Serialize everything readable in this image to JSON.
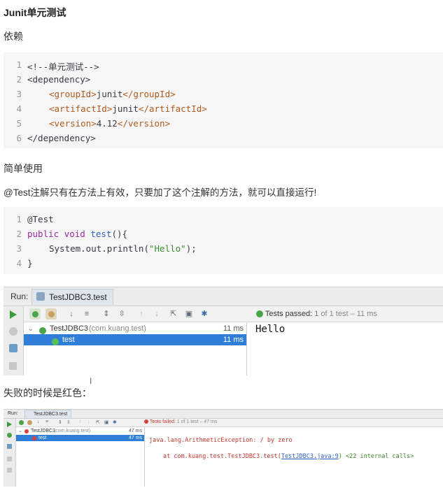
{
  "heading": "Junit单元测试",
  "dep_label": "依赖",
  "dep_code": {
    "line_numbers": [
      "1",
      "2",
      "3",
      "4",
      "5",
      "6"
    ],
    "comment": "<!--单元测试-->",
    "open_dep": "<dependency>",
    "group": {
      "open": "<groupId>",
      "value": "junit",
      "close": "</groupId>"
    },
    "artifact": {
      "open": "<artifactId>",
      "value": "junit",
      "close": "</artifactId>"
    },
    "version": {
      "open": "<version>",
      "value": "4.12",
      "close": "</version>"
    },
    "close_dep": "</dependency>"
  },
  "simple_label": "简单使用",
  "simple_desc": "@Test注解只有在方法上有效，只要加了这个注解的方法，就可以直接运行!",
  "test_code": {
    "line_numbers": [
      "1",
      "2",
      "3",
      "4"
    ],
    "annotation": "@Test",
    "kw_public": "public",
    "kw_void": "void",
    "method": "test",
    "sig_rest": "(){",
    "call": "System.out.println(",
    "str": "\"Hello\"",
    "call_end": ");",
    "close": "}"
  },
  "ide_pass": {
    "run_label": "Run:",
    "tab_label": "TestJDBC3.test",
    "status_prefix": "Tests passed:",
    "status_count": "1",
    "status_rest": "of 1 test – 11 ms",
    "class_name": "TestJDBC3",
    "class_pkg": "(com.kuang.test)",
    "class_time": "11 ms",
    "method_name": "test",
    "method_time": "11 ms",
    "output": "Hello"
  },
  "fail_label": "失败的时候是红色：",
  "ide_fail": {
    "run_label": "Run:",
    "tab_label": "TestJDBC3.test",
    "status_prefix": "Tests failed:",
    "status_rest": "1 of 1 test – 47 ms",
    "class_name": "TestJDBC3",
    "class_pkg": "(com.kuang.test)",
    "class_time": "47 ms",
    "method_name": "test",
    "method_time": "47 ms",
    "exception": "java.lang.ArithmeticException: / by zero",
    "trace_prefix": "at com.kuang.test.TestJDBC3.test(",
    "trace_link": "TestJDBC3.java:9",
    "trace_suffix": ") <22 internal calls>"
  },
  "colors": {
    "pass": "#4aa44a",
    "fail": "#d9403a",
    "selection": "#2f7fd8"
  }
}
